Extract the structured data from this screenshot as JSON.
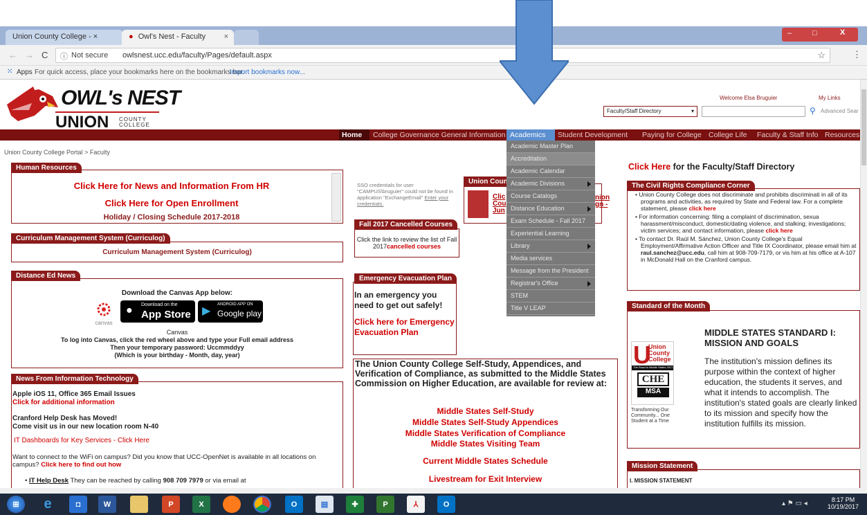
{
  "browser": {
    "tabs": [
      {
        "label": "Union County College - ×"
      },
      {
        "label": "Owl's Nest - Faculty"
      }
    ],
    "security": "Not secure",
    "url": "owlsnest.ucc.edu/faculty/Pages/default.aspx",
    "bookmarks_apps": "Apps",
    "bookmarks_hint": "For quick access, place your bookmarks here on the bookmarks bar.",
    "bookmarks_link": "Import bookmarks now..."
  },
  "header": {
    "logo_top": "OWL's NEST",
    "logo_bottom": "UNION",
    "logo_county": "COUNTY COLLEGE",
    "welcome": "Welcome Elsa Bruguier",
    "mylinks": "My Links",
    "search_scope": "Faculty/Staff Directory",
    "advanced_search": "Advanced Sear"
  },
  "nav": {
    "home": "Home",
    "items": [
      "College Governance General Information",
      "Academics",
      "Student Development",
      "Paying for College",
      "College Life",
      "Faculty & Staff Info",
      "Resources"
    ]
  },
  "dropdown": [
    "Academic Master Plan",
    "Accreditation",
    "Academic Calendar",
    "Academic Divisions",
    "Course Catalogs",
    "Distance Education",
    "Exam Schedule - Fall 2017",
    "Experiential Learning",
    "Library",
    "Media services",
    "Message from the President",
    "Registrar's Office",
    "STEM",
    "Title V LEAP"
  ],
  "breadcrumb": "Union County College Portal > Faculty",
  "hr": {
    "title": "Human Resources",
    "link1": "Click Here for News and Information From HR",
    "link2": "Click Here for Open Enrollment",
    "link3": "Holiday / Closing Schedule 2017-2018"
  },
  "curriculog": {
    "title": "Curriculum Management System (Curriculog)",
    "link": "Curriculum Management System (Curriculog)"
  },
  "distance": {
    "title": "Distance Ed News",
    "download": "Download the Canvas App below:",
    "canvas_label": "canvas",
    "appstore_small": "Download on the",
    "appstore": "App Store",
    "googleplay_small": "ANDROID APP ON",
    "googleplay": "Google play",
    "canvas_heading": "Canvas",
    "line1": "To log into Canvas,  click the red wheel above and type your Full email address",
    "line2": "Then your temporary password:  Uccmmddyy",
    "line3": "(Which is your birthday  -  Month, day,  year)"
  },
  "it": {
    "title": "News From Information Technology",
    "apple": "Apple iOS 11, Office 365 Email Issues",
    "apple_link": "Click for additional information",
    "helpdesk1": "Cranford Help Desk has Moved!",
    "helpdesk2": "Come visit us in our new location room N-40",
    "dash": "IT Dashboards for Key Services - Click Here",
    "wifi_q": "Want to connect to the WiFi on campus?",
    "wifi_text": "Did you know that UCC-OpenNet is available in all locations on campus?",
    "wifi_link": "Click here to find out how",
    "bullet_link": "IT Help Desk",
    "bullet_text": " They can be reached by calling ",
    "bullet_phone": "908 709 7979",
    "bullet_end": " or via email at"
  },
  "sso": {
    "text": "SSO credentials for user \"CAMPUS\\bruguier\" could not be found in application \"ExchangeEmail\"",
    "link": "Enter your credentials."
  },
  "union_promo": {
    "title": "Union Coun",
    "t1": "Clic",
    "t2": "Cou",
    "t3": "Jun",
    "r1": "nion",
    "r2": "gn -"
  },
  "cancelled": {
    "title": "Fall 2017 Cancelled Courses",
    "text": "Click the link to review the list of Fall 2017",
    "link": "cancelled courses"
  },
  "evac": {
    "title": "Emergency Evacuation Plan",
    "text": "In an emergency you need to get out safely!",
    "link": "Click here for Emergency Evacuation Plan"
  },
  "selfstudy": {
    "heading": "The Union County College Self-Study, Appendices, and Verification of Compliance, as submitted to the Middle States Commission on Higher Education, are available for review at:",
    "links": [
      "Middle States Self-Study",
      "Middle States Self-Study Appendices",
      "Middle States Verification of Compliance",
      "Middle States Visiting Team"
    ],
    "schedule": "Current Middle States Schedule",
    "livestream": "Livestream for Exit Interview"
  },
  "directory": {
    "link": "Click Here",
    "rest": " for the Faculty/Staff Directory"
  },
  "civil": {
    "title": "The Civil Rights Compliance Corner",
    "b1": "Union County College does not discriminate and prohibits discriminati in all of its programs and activities, as required by State and Federal law.  For a complete statement, please ",
    "b1_link": "click here",
    "b2": "For information concerning: filing a complaint of discrimination, sexua harassment/misconduct, domestic/dating violence, and stalking; investigations; victim services; and contact information, please ",
    "b2_link": "click here",
    "b3": "To contact Dr. Raúl M. Sánchez, Union County College's Equal Employment/Affirmative Action Officer and Title IX Coordinator, please email him at ",
    "b3_email": "raul.sanchez@ucc.edu",
    "b3_end": ", call him at 908-709-7179, or vis him at his office at A-107 in McDonald Hall on the Cranford campus."
  },
  "standard": {
    "title": "Standard of the Month",
    "logo1": "Union",
    "logo2": "County",
    "logo3": "College",
    "road": "The Road to Middle States 2017",
    "che": "CHE",
    "msa": "MSA",
    "caption": "Transforming Our Community... One Student at a Time",
    "heading": "MIDDLE STATES STANDARD I: MISSION AND GOALS",
    "text": "The institution's mission defines its purpose within the context of higher education, the students it serves, and what it intends to accomplish.  The institution's stated goals are clearly linked to its mission and specify how the institution fulfills its mission."
  },
  "mission": {
    "title": "Mission Statement",
    "text": "I. MISSION STATEMENT"
  },
  "taskbar": {
    "time": "8:17 PM",
    "date": "10/19/2017"
  },
  "colors": {
    "maroon": "#8b1a1a",
    "red_link": "#d00000",
    "arrow": "#5b8fd0"
  }
}
